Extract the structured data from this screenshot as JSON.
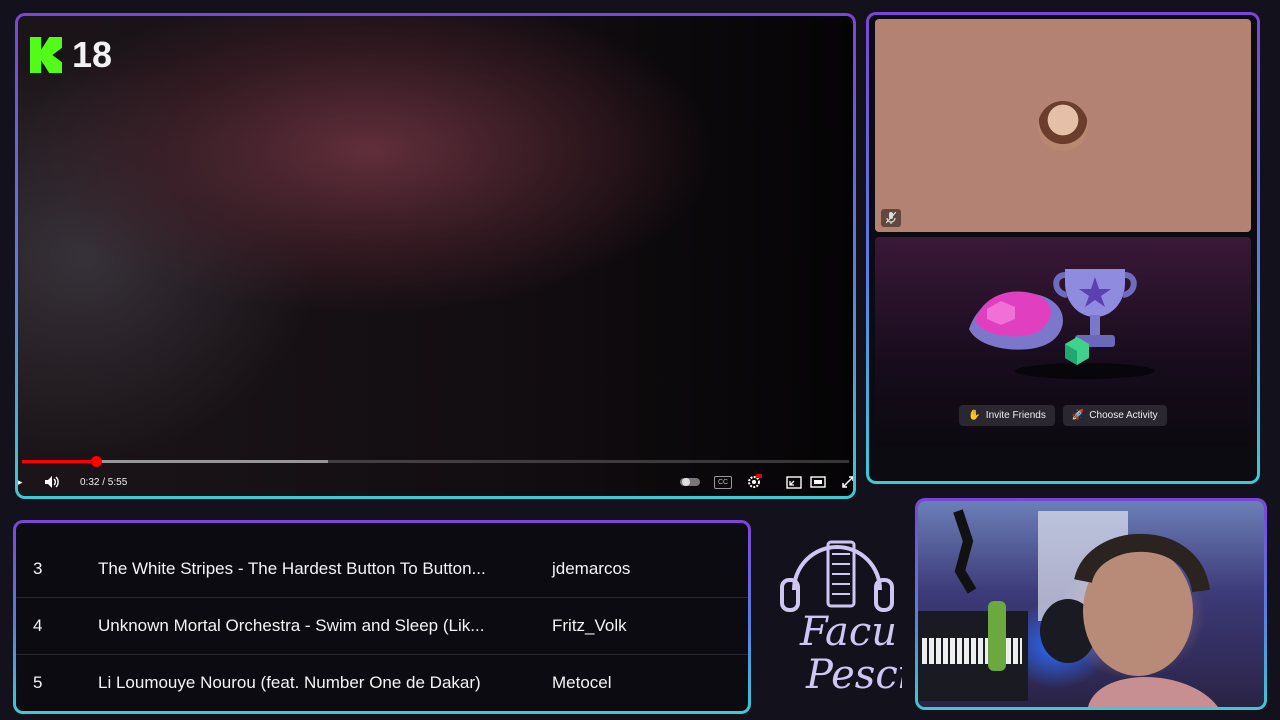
{
  "player": {
    "rating_number": "18",
    "time_display": "0:32 / 5:55",
    "progress_fraction": 0.09,
    "buffer_fraction": 0.37,
    "icons": [
      "play-icon",
      "volume-icon",
      "autoplay-toggle-icon",
      "captions-icon",
      "settings-icon",
      "miniplayer-icon",
      "theater-icon",
      "fullscreen-icon"
    ],
    "cc_label": "CC"
  },
  "call": {
    "activity_buttons": {
      "invite": "Invite Friends",
      "choose": "Choose Activity"
    }
  },
  "queue": {
    "rows": [
      {
        "num": "3",
        "title": "The White Stripes - The Hardest Button To Button...",
        "user": "jdemarcos"
      },
      {
        "num": "4",
        "title": "Unknown Mortal Orchestra - Swim and Sleep (Lik...",
        "user": "Fritz_Volk"
      },
      {
        "num": "5",
        "title": "Li Loumouye Nourou (feat. Number One de Dakar)",
        "user": "Metocel"
      }
    ]
  },
  "logo": {
    "line1": "Facu",
    "line2": "Pesci"
  },
  "colors": {
    "accent_purple": "#7b46d8",
    "accent_cyan": "#3ccbd6",
    "kick_green": "#53fc18",
    "progress_red": "#ff0000"
  }
}
